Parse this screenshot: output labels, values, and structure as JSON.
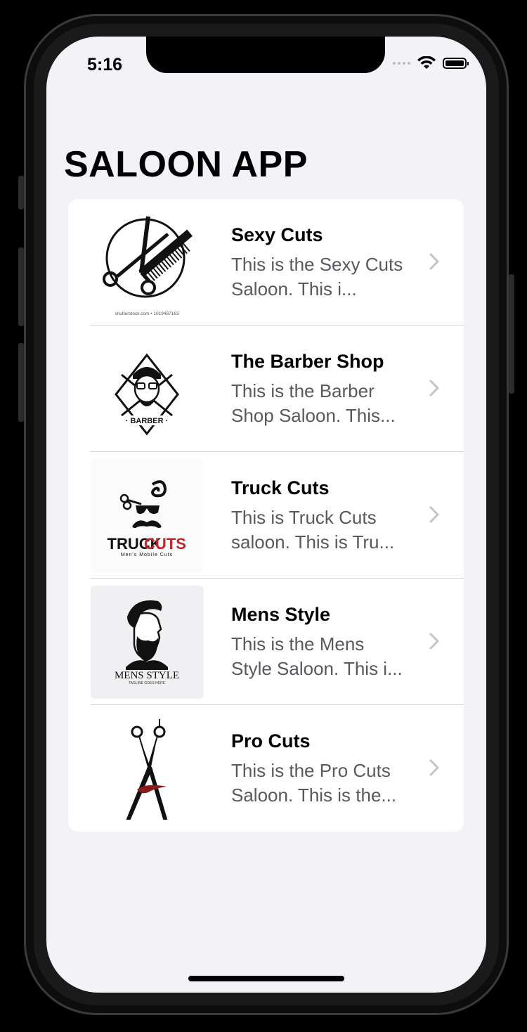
{
  "status_bar": {
    "time": "5:16"
  },
  "header": {
    "title": "SALOON APP"
  },
  "saloons": [
    {
      "name": "Sexy Cuts",
      "description": "This is the Sexy Cuts Saloon. This i...",
      "logo_icon": "scissors-comb-logo-icon",
      "logo_caption": "shutterstock.com • 1019487163"
    },
    {
      "name": "The Barber Shop",
      "description": "This is the Barber Shop Saloon. This...",
      "logo_icon": "bearded-barber-logo-icon",
      "logo_caption": "· BARBER ·"
    },
    {
      "name": "Truck Cuts",
      "description": "This is Truck Cuts saloon. This is Tru...",
      "logo_icon": "mustache-glasses-logo-icon",
      "logo_caption_a": "TRUCK",
      "logo_caption_b": "CUTS",
      "logo_tagline": "Men's Mobile Cuts"
    },
    {
      "name": "Mens Style",
      "description": "This is the Mens Style Saloon. This i...",
      "logo_icon": "bearded-man-profile-logo-icon",
      "logo_caption": "MENS STYLE",
      "logo_tagline": "TAGLINE GOES HERE"
    },
    {
      "name": "Pro Cuts",
      "description": "This is the Pro Cuts Saloon. This is the...",
      "logo_icon": "open-scissors-logo-icon"
    }
  ],
  "colors": {
    "background": "#f2f2f7",
    "card": "#ffffff",
    "separator": "#d1d1d6",
    "chevron": "#c4c4c7",
    "truckcuts_red": "#c0262b"
  }
}
